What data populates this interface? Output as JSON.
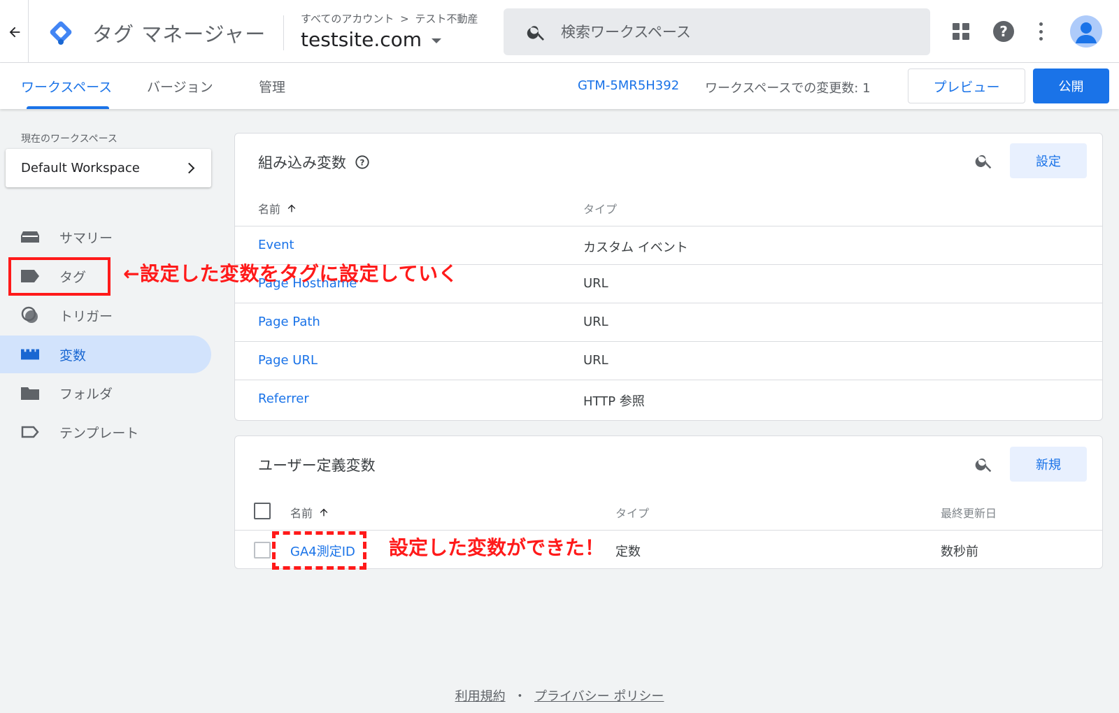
{
  "header": {
    "app_title": "タグ マネージャー",
    "breadcrumb_account": "すべてのアカウント",
    "breadcrumb_separator": ">",
    "breadcrumb_container": "テスト不動産",
    "container_name": "testsite.com",
    "search_placeholder": "検索ワークスペース"
  },
  "subnav": {
    "tabs": [
      {
        "label": "ワークスペース",
        "active": true
      },
      {
        "label": "バージョン"
      },
      {
        "label": "管理"
      }
    ],
    "gtm_id": "GTM-5MR5H392",
    "changes_label": "ワークスペースでの変更数: 1",
    "preview_label": "プレビュー",
    "publish_label": "公開"
  },
  "sidebar": {
    "current_ws_label": "現在のワークスペース",
    "workspace_name": "Default Workspace",
    "items": [
      {
        "label": "サマリー",
        "icon": "summary-icon"
      },
      {
        "label": "タグ",
        "icon": "tag-icon"
      },
      {
        "label": "トリガー",
        "icon": "trigger-icon"
      },
      {
        "label": "変数",
        "icon": "variable-icon",
        "active": true
      },
      {
        "label": "フォルダ",
        "icon": "folder-icon"
      },
      {
        "label": "テンプレート",
        "icon": "template-icon"
      }
    ]
  },
  "builtin": {
    "title": "組み込み変数",
    "config_label": "設定",
    "col_name": "名前",
    "col_type": "タイプ",
    "rows": [
      {
        "name": "Event",
        "type": "カスタム イベント"
      },
      {
        "name": "Page Hostname",
        "type": "URL"
      },
      {
        "name": "Page Path",
        "type": "URL"
      },
      {
        "name": "Page URL",
        "type": "URL"
      },
      {
        "name": "Referrer",
        "type": "HTTP 参照"
      }
    ]
  },
  "userdefined": {
    "title": "ユーザー定義変数",
    "new_label": "新規",
    "col_name": "名前",
    "col_type": "タイプ",
    "col_updated": "最終更新日",
    "rows": [
      {
        "name": "GA4測定ID",
        "type": "定数",
        "updated": "数秒前"
      }
    ]
  },
  "annotations": {
    "tag_note": "←設定した変数をタグに設定していく",
    "created_note": "設定した変数ができた！"
  },
  "footer": {
    "terms": "利用規約",
    "separator": "・",
    "privacy": "プライバシー ポリシー"
  },
  "colors": {
    "accent": "#1a73e8",
    "annotation": "#ff1a1a",
    "active_nav_bg": "#d2e3fc"
  }
}
